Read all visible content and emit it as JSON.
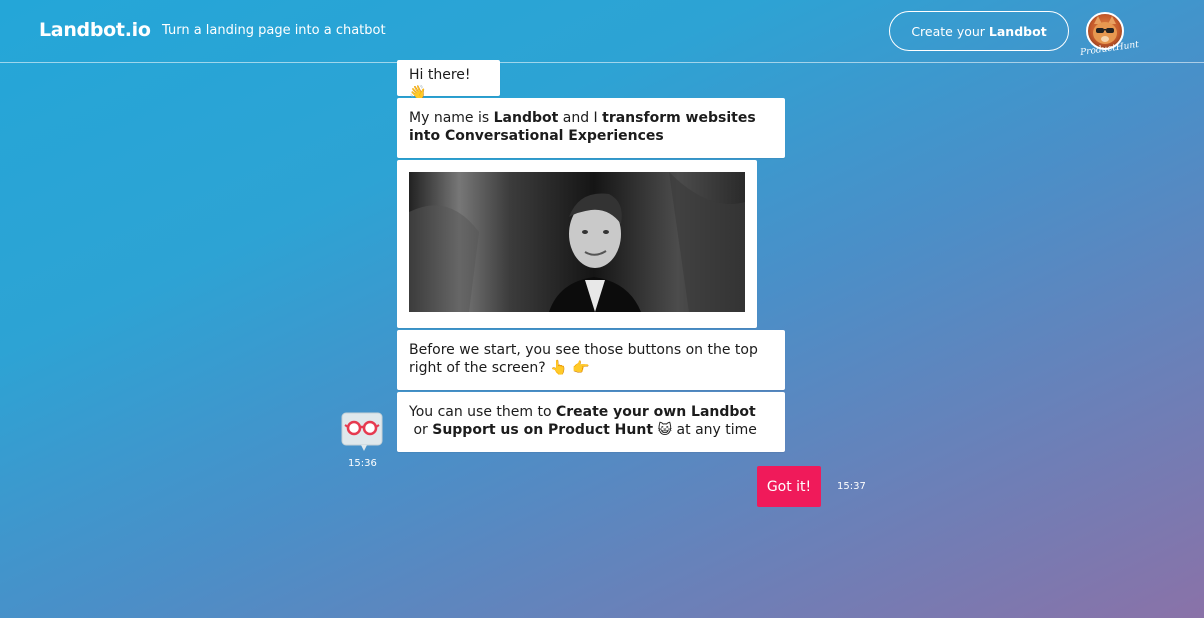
{
  "header": {
    "brand": "Landbot.io",
    "tagline": "Turn a landing page into a chatbot",
    "create_btn_prefix": "Create your ",
    "create_btn_bold": "Landbot",
    "product_hunt_script": "ProductHunt"
  },
  "messages": {
    "m1": {
      "text": "Hi there!",
      "emoji": "👋"
    },
    "m2": {
      "p1": "My name is ",
      "b1": "Landbot",
      "p2": " and I ",
      "b2": "transform websites into Conversational Experiences"
    },
    "m4": {
      "text": "Before we start, you see those buttons on the top right of the screen?",
      "emoji1": "👆",
      "emoji2": "👉"
    },
    "m5": {
      "p1": "You can use them to ",
      "b1": "Create your own Landbot",
      "p2": " or ",
      "b2": "Support us on Product Hunt",
      "emoji": "😺",
      "p3": " at any time"
    }
  },
  "bot_time": "15:36",
  "reply": {
    "label": "Got it!",
    "time": "15:37"
  },
  "icons": {
    "bot_avatar": "robot-glasses-icon",
    "product_hunt": "product-hunt-cat-icon"
  },
  "colors": {
    "reply_bg": "#f01a5a",
    "bubble_bg": "#ffffff",
    "gradient_start": "#24a6d8",
    "gradient_end": "#8a72a8"
  }
}
